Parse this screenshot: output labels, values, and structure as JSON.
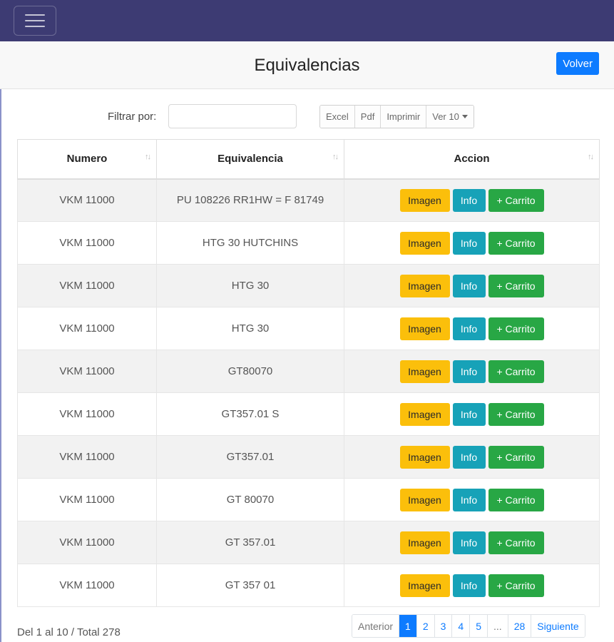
{
  "page": {
    "title": "Equivalencias",
    "back_label": "Volver"
  },
  "filter": {
    "label": "Filtrar por:",
    "value": "",
    "placeholder": ""
  },
  "export_buttons": {
    "excel": "Excel",
    "pdf": "Pdf",
    "print": "Imprimir",
    "page_size": "Ver 10"
  },
  "table": {
    "headers": {
      "numero": "Numero",
      "equivalencia": "Equivalencia",
      "accion": "Accion"
    },
    "sort_glyph": "↑↓",
    "action_labels": {
      "image": "Imagen",
      "info": "Info",
      "cart": "+ Carrito"
    },
    "rows": [
      {
        "numero": "VKM 11000",
        "equivalencia": "PU 108226 RR1HW = F 81749"
      },
      {
        "numero": "VKM 11000",
        "equivalencia": "HTG 30 HUTCHINS"
      },
      {
        "numero": "VKM 11000",
        "equivalencia": "HTG 30"
      },
      {
        "numero": "VKM 11000",
        "equivalencia": "HTG 30"
      },
      {
        "numero": "VKM 11000",
        "equivalencia": "GT80070"
      },
      {
        "numero": "VKM 11000",
        "equivalencia": "GT357.01 S"
      },
      {
        "numero": "VKM 11000",
        "equivalencia": "GT357.01"
      },
      {
        "numero": "VKM 11000",
        "equivalencia": "GT 80070"
      },
      {
        "numero": "VKM 11000",
        "equivalencia": "GT 357.01"
      },
      {
        "numero": "VKM 11000",
        "equivalencia": "GT 357 01"
      }
    ]
  },
  "footer": {
    "summary": "Del 1 al 10 / Total 278",
    "pagination": {
      "prev": "Anterior",
      "pages": [
        "1",
        "2",
        "3",
        "4",
        "5",
        "...",
        "28"
      ],
      "active": "1",
      "next": "Siguiente"
    }
  },
  "colors": {
    "navbar": "#3d3b73",
    "primary": "#0d7bff",
    "warning": "#fbbf0b",
    "info": "#17a2b8",
    "success": "#28a745"
  }
}
